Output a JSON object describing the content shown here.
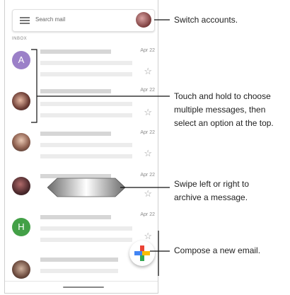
{
  "search": {
    "placeholder": "Search mail"
  },
  "inbox_label": "INBOX",
  "messages": [
    {
      "avatar_letter": "A",
      "avatar_color": "#9b80c8",
      "date": "Apr 22"
    },
    {
      "avatar_letter": "",
      "date": "Apr 22"
    },
    {
      "avatar_letter": "",
      "date": "Apr 22"
    },
    {
      "avatar_letter": "",
      "date": "Apr 22"
    },
    {
      "avatar_letter": "H",
      "avatar_color": "#43a047",
      "date": "Apr 22"
    },
    {
      "avatar_letter": ""
    }
  ],
  "star_glyph": "☆",
  "callouts": {
    "switch_accounts": "Switch accounts.",
    "touch_hold": "Touch and hold to choose multiple messages, then select an option at the top.",
    "swipe": "Swipe left or right to archive a message.",
    "compose": "Compose a new email."
  },
  "icons": [
    "menu-icon",
    "account-avatar-icon",
    "star-icon",
    "swipe-arrow-icon",
    "compose-plus-icon"
  ],
  "colors": {
    "compose_red": "#ea4335",
    "compose_blue": "#4285f4",
    "compose_yellow": "#fbbc05",
    "compose_green": "#34a853"
  }
}
